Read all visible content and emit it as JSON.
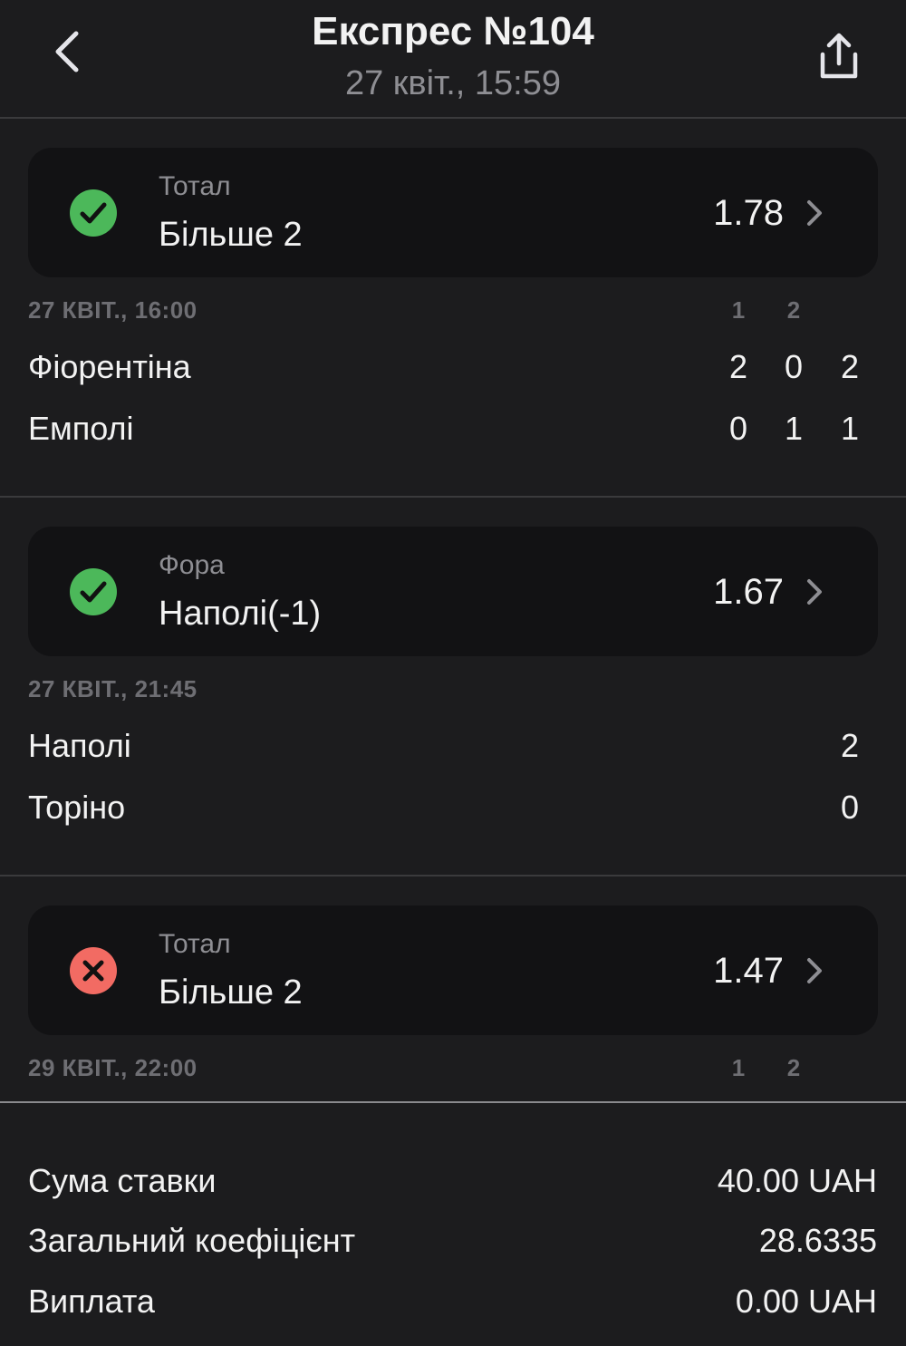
{
  "header": {
    "title": "Експрес №104",
    "subtitle": "27 квіт., 15:59",
    "back_icon": "chevron-left-icon",
    "share_icon": "share-icon"
  },
  "colors": {
    "win": "#4cb85a",
    "loss": "#f26b63"
  },
  "bets": [
    {
      "status": "won",
      "market": "Тотал",
      "selection": "Більше 2",
      "odds": "1.78",
      "match_time": "27 КВІТ., 16:00",
      "period_headers": [
        "1",
        "2"
      ],
      "teams": [
        {
          "name": "Фіорентіна",
          "scores": [
            "2",
            "0",
            "2"
          ]
        },
        {
          "name": "Емполі",
          "scores": [
            "0",
            "1",
            "1"
          ]
        }
      ]
    },
    {
      "status": "won",
      "market": "Фора",
      "selection": "Наполі(-1)",
      "odds": "1.67",
      "match_time": "27 КВІТ., 21:45",
      "period_headers": [],
      "teams": [
        {
          "name": "Наполі",
          "scores": [
            "2"
          ]
        },
        {
          "name": "Торіно",
          "scores": [
            "0"
          ]
        }
      ]
    },
    {
      "status": "lost",
      "market": "Тотал",
      "selection": "Більше 2",
      "odds": "1.47",
      "match_time": "29 КВІТ., 22:00",
      "period_headers": [
        "1",
        "2"
      ],
      "teams": []
    }
  ],
  "summary": {
    "stake_label": "Сума ставки",
    "stake_value": "40.00 UAH",
    "total_odds_label": "Загальний коефіцієнт",
    "total_odds_value": "28.6335",
    "payout_label": "Виплата",
    "payout_value": "0.00 UAH"
  }
}
